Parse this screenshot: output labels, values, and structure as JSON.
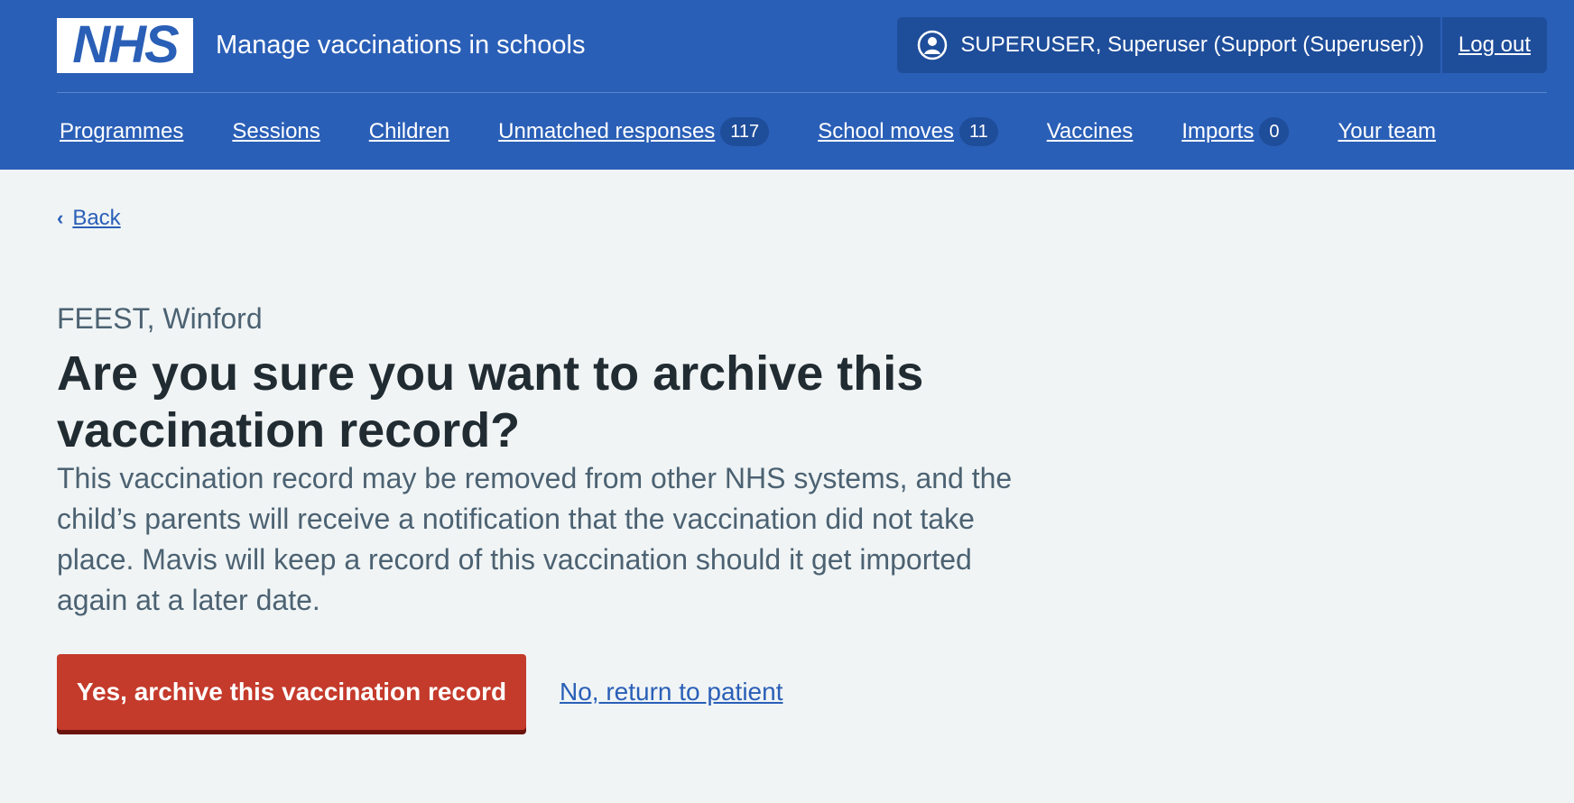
{
  "header": {
    "logo_text": "NHS",
    "service_name": "Manage vaccinations in schools",
    "account": {
      "icon": "user-circle-icon",
      "name": "SUPERUSER, Superuser (Support (Superuser))",
      "logout_label": "Log out"
    },
    "colors": {
      "header_bg": "#2a5fb7",
      "account_bg": "#1e4d9a"
    }
  },
  "nav": {
    "items": [
      {
        "label": "Programmes"
      },
      {
        "label": "Sessions"
      },
      {
        "label": "Children"
      },
      {
        "label": "Unmatched responses",
        "count": "117"
      },
      {
        "label": "School moves",
        "count": "11"
      },
      {
        "label": "Vaccines"
      },
      {
        "label": "Imports",
        "count": "0"
      },
      {
        "label": "Your team"
      }
    ]
  },
  "main": {
    "back_label": "Back",
    "caption": "FEEST, Winford",
    "heading": "Are you sure you want to archive this vaccination record?",
    "lede": "This vaccination record may be removed from other NHS systems, and the child’s parents will receive a notification that the vaccination did not take place. Mavis will keep a record of this vaccination should it get imported again at a later date.",
    "confirm_button": "Yes, archive this vaccination record",
    "cancel_link": "No, return to patient",
    "colors": {
      "warning_button": "#c43a2b",
      "link": "#2a5fb7",
      "page_bg": "#f0f4f5"
    }
  }
}
